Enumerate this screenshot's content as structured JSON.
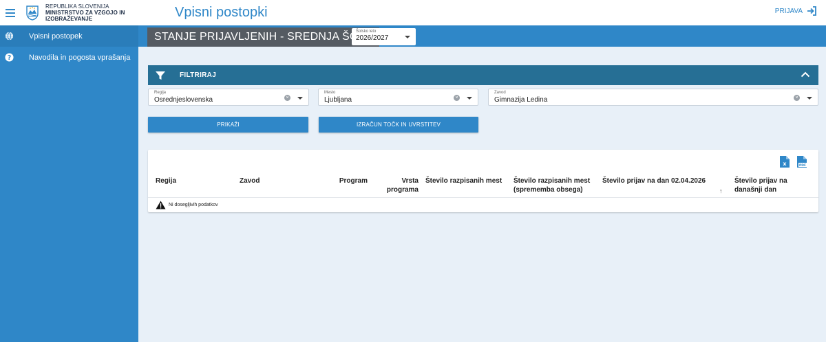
{
  "header": {
    "ministry_line1": "REPUBLIKA SLOVENIJA",
    "ministry_line2": "MINISTRSTVO ZA VZGOJO IN IZOBRAŽEVANJE",
    "app_title": "Vpisni postopki",
    "login_label": "PRIJAVA",
    "accent_color": "#2f87c8"
  },
  "sidebar": {
    "items": [
      {
        "label": "Vpisni postopek",
        "icon": "globe-icon"
      },
      {
        "label": "Navodila in pogosta vprašanja",
        "icon": "help-icon"
      }
    ]
  },
  "page": {
    "title": "STANJE PRIJAVLJENIH - SREDNJA ŠOLA",
    "year_select": {
      "label": "Šolsko leto",
      "value": "2026/2027"
    }
  },
  "filter": {
    "title": "FILTRIRAJ",
    "fields": [
      {
        "label": "Regija",
        "value": "Osrednjeslovenska"
      },
      {
        "label": "Mesto",
        "value": "Ljubljana"
      },
      {
        "label": "Zavod",
        "value": "Gimnazija Ledina"
      }
    ],
    "show_button": "PRIKAŽI",
    "calc_button": "IZRAČUN TOČK IN UVRSTITEV"
  },
  "table": {
    "columns": [
      "Regija",
      "Zavod",
      "Program",
      "Vrsta programa",
      "Število razpisanih mest",
      "Število razpisanih mest (sprememba obsega)",
      "Število prijav na dan 02.04.2026",
      "Število prijav na današnji dan"
    ],
    "empty_message": "Ni dosegljivih podatkov",
    "export_icons": [
      "excel-icon",
      "pdf-icon"
    ]
  }
}
